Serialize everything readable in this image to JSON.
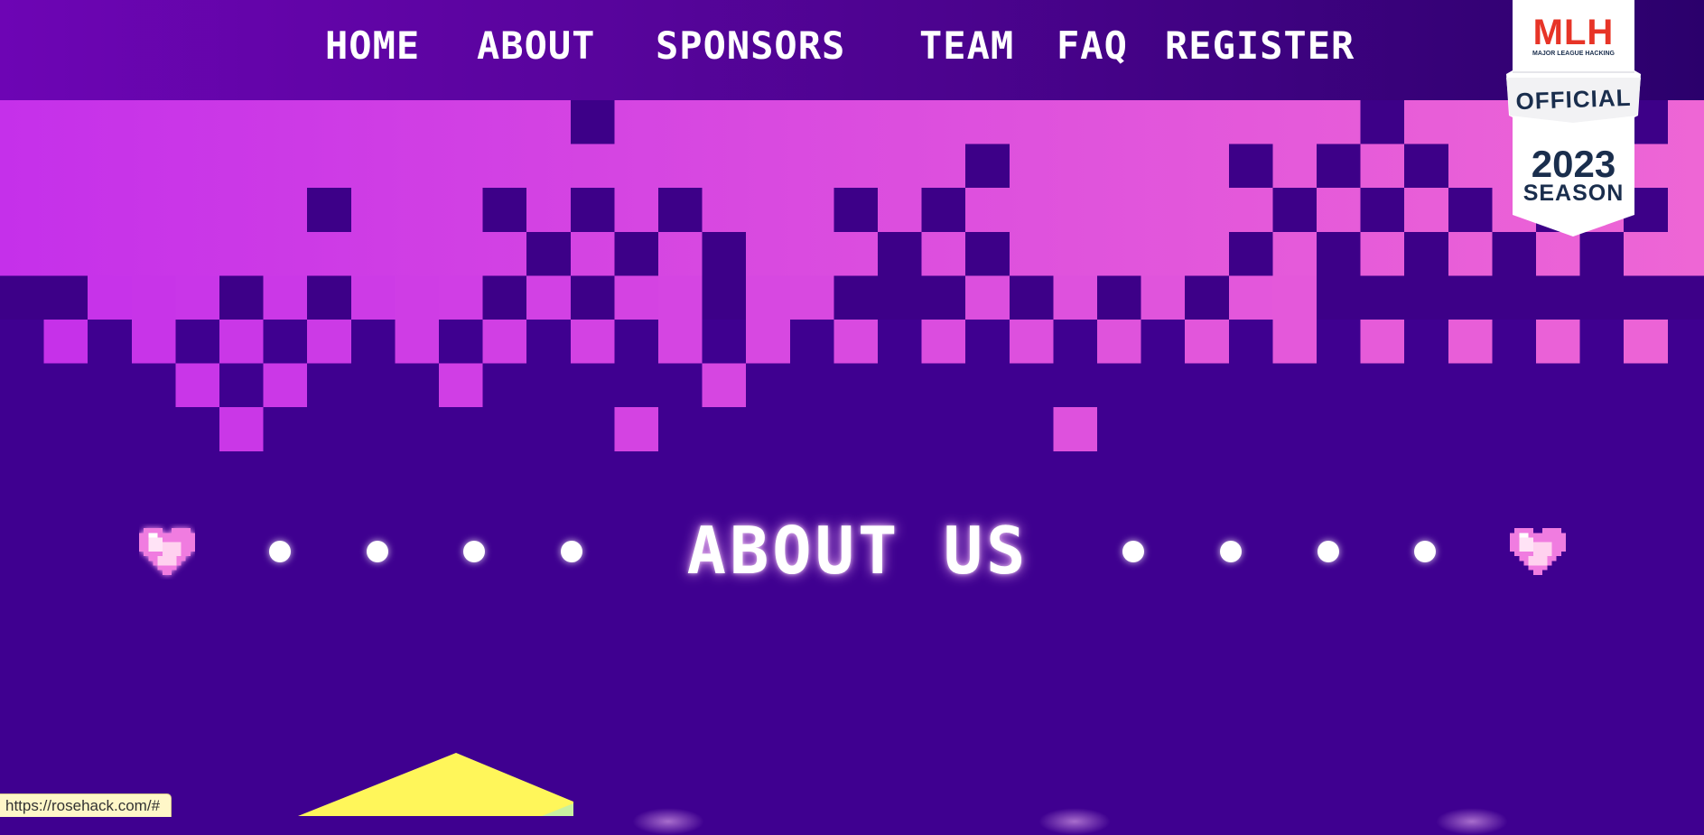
{
  "nav": {
    "items": [
      {
        "label": "HOME",
        "name": "nav-home"
      },
      {
        "label": "ABOUT",
        "name": "nav-about"
      },
      {
        "label": "SPONSORS",
        "name": "nav-sponsors"
      },
      {
        "label": "TEAM",
        "name": "nav-team"
      },
      {
        "label": "FAQ",
        "name": "nav-faq"
      },
      {
        "label": "REGISTER",
        "name": "nav-register"
      }
    ]
  },
  "mlh_badge": {
    "logo_text": "MLH",
    "tagline": "MAJOR LEAGUE HACKING",
    "official": "OFFICIAL",
    "year": "2023",
    "season": "SEASON"
  },
  "section": {
    "title": "ABOUT US",
    "left_icon": "pixel-heart-icon",
    "right_icon": "pixel-heart-icon"
  },
  "status_bar": {
    "url": "https://rosehack.com/#"
  },
  "colors": {
    "nav_start": "#6d05b4",
    "nav_end": "#2b006c",
    "banner_start": "#c530ea",
    "banner_end": "#ee66d5",
    "background": "#3f0090",
    "dark_pixel": "#3d0088",
    "accent_yellow": "#fff65a",
    "mlh_red": "#e73427",
    "mlh_blue": "#1d539f",
    "mlh_yellow": "#f8b92a",
    "badge_text": "#1a2e4d"
  }
}
